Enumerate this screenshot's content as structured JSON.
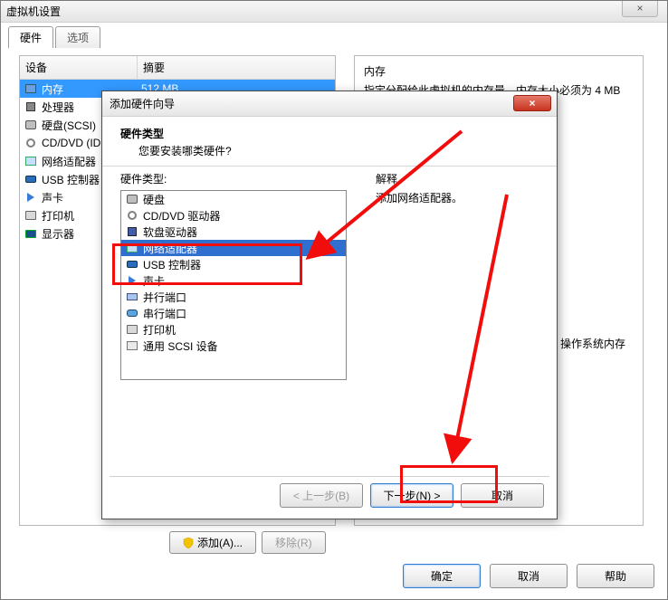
{
  "vm_window": {
    "title": "虚拟机设置",
    "close_glyph": "×",
    "tabs": {
      "hardware": "硬件",
      "options": "选项"
    },
    "columns": {
      "device": "设备",
      "summary": "摘要"
    },
    "devices": [
      {
        "icon": "chip",
        "name": "内存",
        "summary": "512 MB",
        "selected": true
      },
      {
        "icon": "cpu",
        "name": "处理器",
        "summary": ""
      },
      {
        "icon": "hdd",
        "name": "硬盘(SCSI)",
        "summary": ""
      },
      {
        "icon": "cd",
        "name": "CD/DVD (ID",
        "summary": ""
      },
      {
        "icon": "net",
        "name": "网络适配器",
        "summary": ""
      },
      {
        "icon": "usb",
        "name": "USB 控制器",
        "summary": ""
      },
      {
        "icon": "snd",
        "name": "声卡",
        "summary": ""
      },
      {
        "icon": "prn",
        "name": "打印机",
        "summary": ""
      },
      {
        "icon": "mon",
        "name": "显示器",
        "summary": ""
      }
    ],
    "memory_panel": {
      "title": "内存",
      "desc": "指定分配给此虚拟机的内存量。内存大小必须为 4 MB"
    },
    "os_mem_note": "操作系统内存",
    "buttons": {
      "add": "添加(A)...",
      "remove": "移除(R)",
      "ok": "确定",
      "cancel": "取消",
      "help": "帮助"
    }
  },
  "wizard": {
    "title": "添加硬件向导",
    "close_glyph": "×",
    "header": {
      "title": "硬件类型",
      "subtitle": "您要安装哪类硬件?"
    },
    "list_label": "硬件类型:",
    "items": [
      {
        "icon": "hdd",
        "label": "硬盘"
      },
      {
        "icon": "cd",
        "label": "CD/DVD 驱动器"
      },
      {
        "icon": "floppy",
        "label": "软盘驱动器"
      },
      {
        "icon": "net",
        "label": "网络适配器",
        "selected": true
      },
      {
        "icon": "usb",
        "label": "USB 控制器"
      },
      {
        "icon": "snd",
        "label": "声卡"
      },
      {
        "icon": "par",
        "label": "并行端口"
      },
      {
        "icon": "ser",
        "label": "串行端口"
      },
      {
        "icon": "prn",
        "label": "打印机"
      },
      {
        "icon": "scsi",
        "label": "通用 SCSI 设备"
      }
    ],
    "explain": {
      "title": "解释",
      "desc": "添加网络适配器。"
    },
    "buttons": {
      "back": "< 上一步(B)",
      "next": "下一步(N) >",
      "cancel": "取消"
    }
  }
}
